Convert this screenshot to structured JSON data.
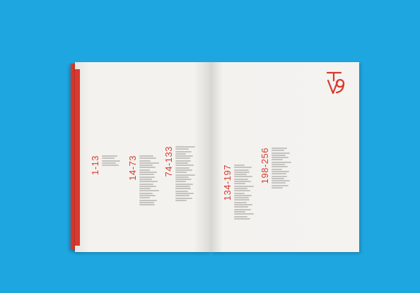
{
  "scene": "open book on blue background",
  "colors": {
    "background": "#1ea6e0",
    "accent": "#d9392e",
    "paper": "#f2f1ee"
  },
  "sections": [
    {
      "range": "1-13",
      "lines": 5
    },
    {
      "range": "14-73",
      "lines": 22
    },
    {
      "range": "74-133",
      "lines": 24
    },
    {
      "range": "134-197",
      "lines": 24
    },
    {
      "range": "198-256",
      "lines": 18
    }
  ]
}
